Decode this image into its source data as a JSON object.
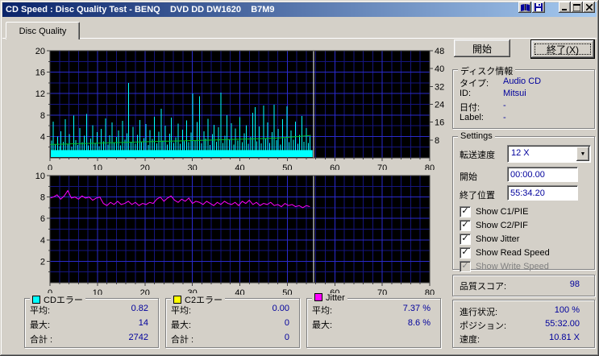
{
  "titlebar": {
    "title": "CD Speed : Disc Quality Test - BENQ    DVD DD DW1620    B7M9",
    "icons": [
      "compare-icon",
      "save-icon",
      "minimize-icon",
      "maximize-icon",
      "close-icon"
    ]
  },
  "tab": {
    "label": "Disc Quality"
  },
  "buttons": {
    "start": "開始",
    "exit": "終了(X)"
  },
  "disc_info": {
    "title": "ディスク情報",
    "rows": [
      {
        "label": "タイプ:",
        "value": "Audio CD"
      },
      {
        "label": "ID:",
        "value": "Mitsui"
      },
      {
        "label": "日付:",
        "value": "-"
      },
      {
        "label": "Label:",
        "value": "-"
      }
    ]
  },
  "settings": {
    "title": "Settings",
    "speed_label": "転送速度",
    "speed_value": "12 X",
    "start_label": "開始",
    "start_value": "00:00.00",
    "end_label": "終了位置",
    "end_value": "55:34.20",
    "checkboxes": [
      {
        "slug": "show-c1-pie",
        "label": "Show C1/PIE",
        "checked": true,
        "disabled": false
      },
      {
        "slug": "show-c2-pif",
        "label": "Show C2/PIF",
        "checked": true,
        "disabled": false
      },
      {
        "slug": "show-jitter",
        "label": "Show Jitter",
        "checked": true,
        "disabled": false
      },
      {
        "slug": "show-read-speed",
        "label": "Show Read Speed",
        "checked": true,
        "disabled": false
      },
      {
        "slug": "show-write-speed",
        "label": "Show Write Speed",
        "checked": true,
        "disabled": true
      }
    ]
  },
  "score": {
    "label": "品質スコア:",
    "value": "98"
  },
  "status": {
    "rows": [
      {
        "label": "進行状況:",
        "value": "100 %"
      },
      {
        "label": "ポジション:",
        "value": "55:32.00"
      },
      {
        "label": "速度:",
        "value": "10.81 X"
      }
    ]
  },
  "legend_boxes": [
    {
      "title": "CDエラー",
      "color": "#00FFFF",
      "rows": [
        [
          "平均:",
          "0.82"
        ],
        [
          "最大:",
          "14"
        ],
        [
          "合計 :",
          "2742"
        ]
      ]
    },
    {
      "title": "C2エラー",
      "color": "#FFFF00",
      "rows": [
        [
          "平均:",
          "0.00"
        ],
        [
          "最大:",
          "0"
        ],
        [
          "合計 :",
          "0"
        ]
      ]
    },
    {
      "title": "Jitter",
      "color": "#FF00FF",
      "rows": [
        [
          "平均:",
          "7.37 %"
        ],
        [
          "最大:",
          "8.6 %"
        ]
      ]
    }
  ],
  "chart_data": [
    {
      "type": "bar",
      "title": "C1 errors (cyan bars, left axis) and read speed (green line, right axis)",
      "x_range": [
        0,
        80
      ],
      "x_ticks": [
        0,
        10,
        20,
        30,
        40,
        50,
        60,
        70,
        80
      ],
      "x_minor_step": 2,
      "left_axis": {
        "range": [
          0,
          20
        ],
        "ticks": [
          4,
          8,
          12,
          16,
          20
        ],
        "minor_step": 2
      },
      "right_axis": {
        "range": [
          0,
          48
        ],
        "ticks": [
          8,
          16,
          24,
          32,
          40,
          48
        ]
      },
      "cursor_x": 55.5,
      "colors": {
        "bg": "#000000",
        "grid_major": "#2A2ACC",
        "grid_minor": "#15157E",
        "c1": "#00FFFF",
        "read": "#00BE28",
        "cursor": "#FFFFFF"
      },
      "c1_baseline": 1.45,
      "c1_spikes": [
        [
          0.3,
          3.2
        ],
        [
          0.7,
          6.8
        ],
        [
          1.1,
          2.5
        ],
        [
          1.6,
          4.0
        ],
        [
          2.0,
          2.2
        ],
        [
          2.3,
          5.0
        ],
        [
          2.8,
          3.0
        ],
        [
          3.2,
          7.2
        ],
        [
          3.7,
          2.6
        ],
        [
          4.1,
          4.4
        ],
        [
          4.6,
          2.1
        ],
        [
          5.0,
          7.9
        ],
        [
          5.4,
          3.3
        ],
        [
          5.9,
          2.4
        ],
        [
          6.3,
          5.6
        ],
        [
          6.8,
          2.9
        ],
        [
          7.2,
          4.1
        ],
        [
          7.7,
          8.2
        ],
        [
          8.1,
          2.3
        ],
        [
          8.6,
          3.6
        ],
        [
          9.0,
          6.1
        ],
        [
          9.5,
          2.7
        ],
        [
          9.9,
          4.8
        ],
        [
          10.4,
          2.2
        ],
        [
          10.8,
          5.4
        ],
        [
          11.3,
          3.1
        ],
        [
          11.7,
          7.4
        ],
        [
          12.2,
          2.5
        ],
        [
          12.6,
          4.2
        ],
        [
          13.1,
          6.6
        ],
        [
          13.5,
          2.8
        ],
        [
          14.0,
          3.9
        ],
        [
          14.4,
          5.1
        ],
        [
          14.9,
          2.3
        ],
        [
          15.3,
          6.9
        ],
        [
          15.8,
          3.4
        ],
        [
          16.2,
          4.6
        ],
        [
          16.6,
          14.0
        ],
        [
          17.1,
          3.0
        ],
        [
          17.5,
          5.8
        ],
        [
          18.0,
          2.6
        ],
        [
          18.4,
          4.3
        ],
        [
          18.9,
          7.1
        ],
        [
          19.3,
          2.9
        ],
        [
          19.8,
          3.7
        ],
        [
          20.2,
          6.3
        ],
        [
          20.7,
          2.4
        ],
        [
          21.1,
          5.2
        ],
        [
          21.6,
          3.5
        ],
        [
          22.0,
          7.7
        ],
        [
          22.5,
          2.7
        ],
        [
          22.9,
          4.9
        ],
        [
          23.4,
          9.2
        ],
        [
          23.8,
          3.2
        ],
        [
          24.3,
          6.0
        ],
        [
          24.7,
          2.5
        ],
        [
          25.2,
          4.5
        ],
        [
          25.6,
          7.5
        ],
        [
          26.1,
          2.8
        ],
        [
          26.5,
          3.8
        ],
        [
          27.0,
          6.4
        ],
        [
          27.4,
          2.6
        ],
        [
          27.9,
          5.3
        ],
        [
          28.3,
          3.1
        ],
        [
          28.8,
          7.0
        ],
        [
          29.2,
          2.9
        ],
        [
          29.7,
          4.7
        ],
        [
          30.1,
          12.0
        ],
        [
          30.6,
          3.3
        ],
        [
          31.0,
          6.7
        ],
        [
          31.5,
          11.5
        ],
        [
          31.9,
          2.7
        ],
        [
          32.4,
          5.0
        ],
        [
          32.8,
          3.6
        ],
        [
          33.3,
          7.3
        ],
        [
          33.7,
          2.4
        ],
        [
          34.2,
          4.4
        ],
        [
          34.6,
          6.2
        ],
        [
          35.1,
          3.0
        ],
        [
          35.5,
          5.7
        ],
        [
          36.0,
          12.2
        ],
        [
          36.4,
          2.8
        ],
        [
          36.9,
          4.1
        ],
        [
          37.3,
          8.0
        ],
        [
          37.8,
          3.4
        ],
        [
          38.2,
          6.5
        ],
        [
          38.7,
          2.5
        ],
        [
          39.1,
          5.5
        ],
        [
          39.6,
          3.2
        ],
        [
          40.0,
          7.6
        ],
        [
          40.5,
          2.9
        ],
        [
          40.9,
          4.6
        ],
        [
          41.4,
          6.1
        ],
        [
          41.8,
          2.6
        ],
        [
          42.3,
          3.9
        ],
        [
          42.7,
          8.4
        ],
        [
          43.2,
          9.5
        ],
        [
          43.6,
          3.1
        ],
        [
          44.1,
          5.9
        ],
        [
          44.5,
          2.7
        ],
        [
          45.0,
          9.8
        ],
        [
          45.4,
          3.5
        ],
        [
          45.9,
          6.6
        ],
        [
          46.3,
          2.8
        ],
        [
          46.8,
          4.8
        ],
        [
          47.2,
          9.9
        ],
        [
          47.7,
          3.3
        ],
        [
          48.1,
          5.4
        ],
        [
          48.6,
          2.5
        ],
        [
          49.0,
          7.2
        ],
        [
          49.5,
          3.7
        ],
        [
          49.9,
          9.6
        ],
        [
          50.4,
          2.9
        ],
        [
          50.8,
          5.1
        ],
        [
          51.3,
          3.4
        ],
        [
          51.7,
          6.8
        ],
        [
          52.2,
          2.6
        ],
        [
          52.6,
          4.3
        ],
        [
          53.1,
          7.8
        ],
        [
          53.5,
          3.0
        ],
        [
          54.0,
          5.6
        ],
        [
          54.4,
          2.8
        ],
        [
          54.8,
          4.0
        ]
      ],
      "read_speed": {
        "axis": "right",
        "x_step": 2.5,
        "values": [
          6.0,
          6.15,
          6.3,
          6.45,
          6.6,
          6.75,
          6.9,
          7.05,
          7.2,
          7.35,
          7.5,
          7.6,
          7.75,
          7.9,
          8.05,
          8.2,
          8.35,
          8.5,
          8.65,
          8.85,
          9.2,
          9.6,
          10.05
        ]
      }
    },
    {
      "type": "line",
      "title": "Jitter % (magenta line)",
      "x_range": [
        0,
        80
      ],
      "x_ticks": [
        0,
        10,
        20,
        30,
        40,
        50,
        60,
        70,
        80
      ],
      "x_minor_step": 2,
      "left_axis": {
        "range": [
          0,
          10
        ],
        "ticks": [
          2,
          4,
          6,
          8,
          10
        ],
        "minor_step": 1
      },
      "cursor_x": 55.5,
      "colors": {
        "bg": "#000000",
        "grid_major": "#2A2ACC",
        "grid_minor": "#15157E",
        "jitter": "#FF00FF",
        "cursor": "#FFFFFF"
      },
      "jitter": {
        "x_step": 0.75,
        "values": [
          7.9,
          8.0,
          8.2,
          7.8,
          8.1,
          8.6,
          7.9,
          8.0,
          7.8,
          8.1,
          7.9,
          8.0,
          7.7,
          7.9,
          8.0,
          7.4,
          7.2,
          7.5,
          7.3,
          7.6,
          7.3,
          7.4,
          7.6,
          7.3,
          7.5,
          7.2,
          7.4,
          7.3,
          7.5,
          7.4,
          7.8,
          8.0,
          7.6,
          7.9,
          8.1,
          7.7,
          7.5,
          7.8,
          7.6,
          7.9,
          7.4,
          7.6,
          7.5,
          7.3,
          7.6,
          7.4,
          7.2,
          7.5,
          7.3,
          7.6,
          7.4,
          7.3,
          7.5,
          7.2,
          7.6,
          7.4,
          7.7,
          7.3,
          7.5,
          7.2,
          7.4,
          7.3,
          7.5,
          7.2,
          7.3,
          7.1,
          7.4,
          7.2,
          7.3,
          7.1,
          7.2,
          7.0,
          7.2,
          7.1
        ]
      }
    }
  ]
}
